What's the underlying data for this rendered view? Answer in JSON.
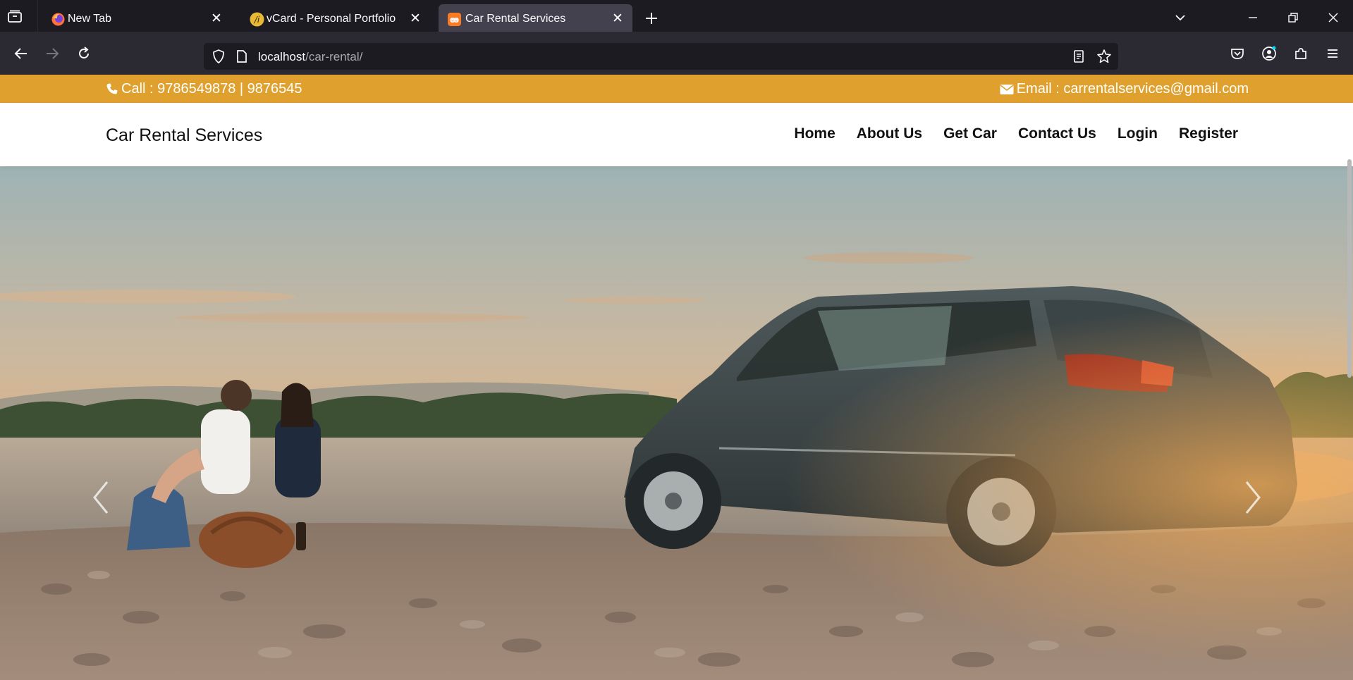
{
  "browser": {
    "tabs": [
      {
        "label": "New Tab"
      },
      {
        "label": "vCard - Personal Portfolio"
      },
      {
        "label": "Car Rental Services"
      }
    ],
    "url": {
      "host": "localhost",
      "path": "/car-rental/"
    }
  },
  "site": {
    "topbar": {
      "call": "Call : 9786549878 | 9876545",
      "email": "Email : carrentalservices@gmail.com"
    },
    "brand": "Car Rental Services",
    "menu": [
      "Home",
      "About Us",
      "Get Car",
      "Contact Us",
      "Login",
      "Register"
    ]
  },
  "colors": {
    "accent": "#e0a02e",
    "chrome_dark": "#1c1b22",
    "chrome_mid": "#2b2a33",
    "tab_active": "#42414d"
  },
  "icons": {
    "tab_list": "tab-list-icon",
    "phone": "phone-icon",
    "email": "envelope-icon",
    "carousel_prev": "chevron-left-icon",
    "carousel_next": "chevron-right-icon"
  }
}
